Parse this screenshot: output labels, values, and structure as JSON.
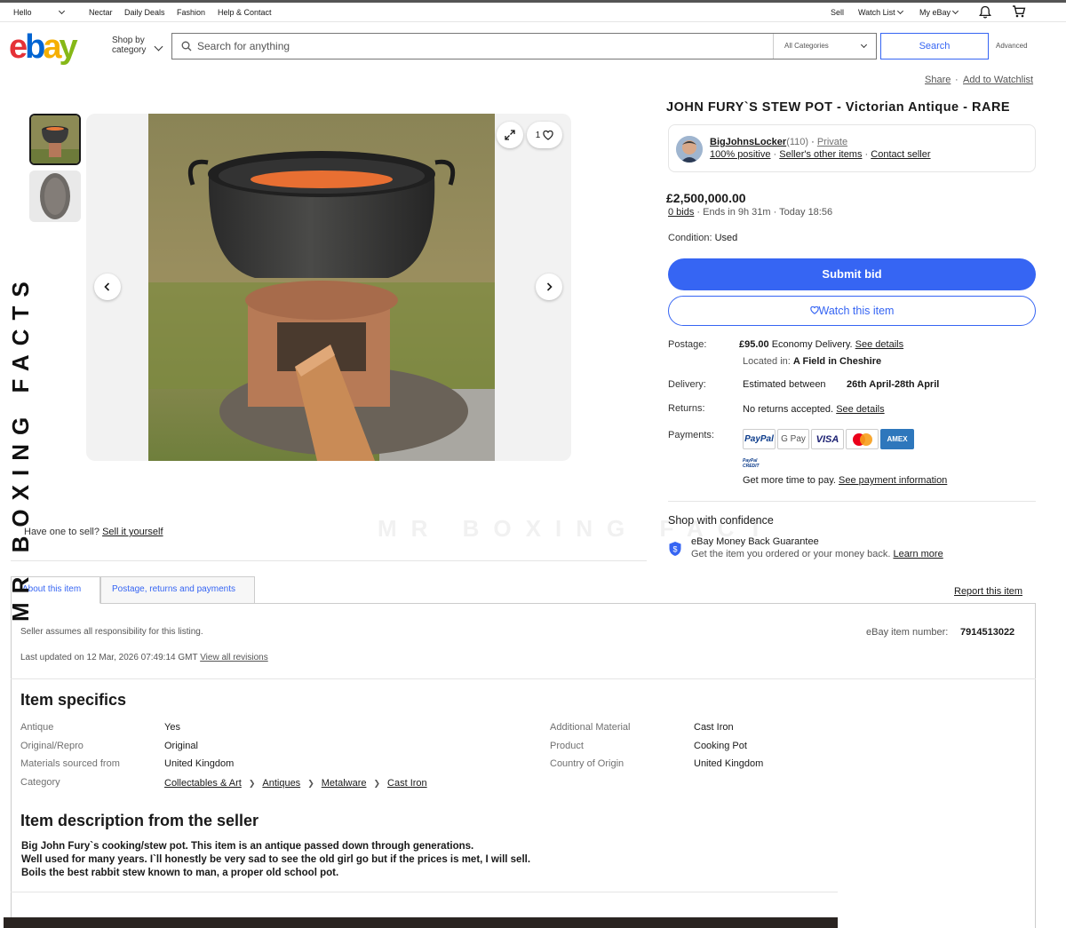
{
  "topnav": {
    "hello": "Hello",
    "links": [
      "Nectar",
      "Daily Deals",
      "Fashion",
      "Help & Contact"
    ],
    "sell": "Sell",
    "watch_list": "Watch List",
    "my_ebay": "My eBay"
  },
  "header": {
    "logo": [
      "e",
      "b",
      "a",
      "y"
    ],
    "shop_by": "Shop by",
    "category": "category",
    "search_placeholder": "Search for anything",
    "all_categories": "All Categories",
    "search_button": "Search",
    "advanced": "Advanced"
  },
  "actions": {
    "share": "Share",
    "add_to_watchlist": "Add to Watchlist"
  },
  "gallery": {
    "image_counter": "1"
  },
  "watermark": {
    "vertical": "MR BOXING FACTS",
    "faint": "MR BOXING FACT"
  },
  "sell_prompt": {
    "text": "Have one to sell?",
    "link": "Sell it yourself"
  },
  "listing": {
    "title": "JOHN FURY`S STEW POT - Victorian Antique - RARE",
    "seller": {
      "name": "BigJohnsLocker",
      "feedback_count": "(110)",
      "type": "Private",
      "positive": "100% positive",
      "other_items": "Seller's other items",
      "contact": "Contact seller"
    },
    "price": "£2,500,000.00",
    "bids": "0 bids",
    "ends": "Ends in 9h 31m",
    "end_time": "Today 18:56",
    "condition_label": "Condition:",
    "condition_value": "Used",
    "submit_bid": "Submit bid",
    "watch_item": "Watch this item",
    "postage_label": "Postage:",
    "postage_price": "£95.00",
    "postage_desc": "Economy Delivery.",
    "see_details": "See details",
    "located_in_label": "Located in:",
    "located_in": "A Field in Cheshire",
    "delivery_label": "Delivery:",
    "delivery_desc": "Estimated between",
    "delivery_dates": "26th April-28th April",
    "returns_label": "Returns:",
    "returns_value": "No returns accepted.",
    "returns_link": "See details",
    "payments_label": "Payments:",
    "payment_methods": [
      "PayPal",
      "G Pay",
      "VISA",
      "Mastercard",
      "AMEX"
    ],
    "paypal_credit": "PayPal CREDIT",
    "more_time": "Get more time to pay.",
    "payment_info_link": "See payment information",
    "shop_confidence": "Shop with confidence",
    "money_back": "eBay Money Back Guarantee",
    "money_back_desc": "Get the item you ordered or your money back.",
    "learn_more": "Learn more"
  },
  "tabs": {
    "about": "About this item",
    "postage": "Postage, returns and payments",
    "report": "Report this item"
  },
  "details": {
    "responsibility": "Seller assumes all responsibility for this listing.",
    "last_updated": "Last updated on 12 Mar, 2026 07:49:14 GMT",
    "view_revisions": "View all revisions",
    "item_number_label": "eBay item number:",
    "item_number": "7914513022",
    "specifics_heading": "Item specifics",
    "left_specs": [
      {
        "k": "Antique",
        "v": "Yes"
      },
      {
        "k": "Original/Repro",
        "v": "Original"
      },
      {
        "k": "Materials sourced from",
        "v": "United Kingdom"
      }
    ],
    "right_specs": [
      {
        "k": "Additional Material",
        "v": "Cast Iron"
      },
      {
        "k": "Product",
        "v": "Cooking Pot"
      },
      {
        "k": "Country of Origin",
        "v": "United Kingdom"
      }
    ],
    "category_label": "Category",
    "category_path": [
      "Collectables & Art",
      "Antiques",
      "Metalware",
      "Cast Iron"
    ],
    "description_heading": "Item description from the seller",
    "description_lines": [
      "Big John Fury`s cooking/stew pot. This item is an antique passed down through generations.",
      "Well used for many years. I`ll honestly be very sad to see the old girl go but if the prices is met, I will sell.",
      "Boils the best rabbit stew known to man, a proper old school pot."
    ]
  }
}
